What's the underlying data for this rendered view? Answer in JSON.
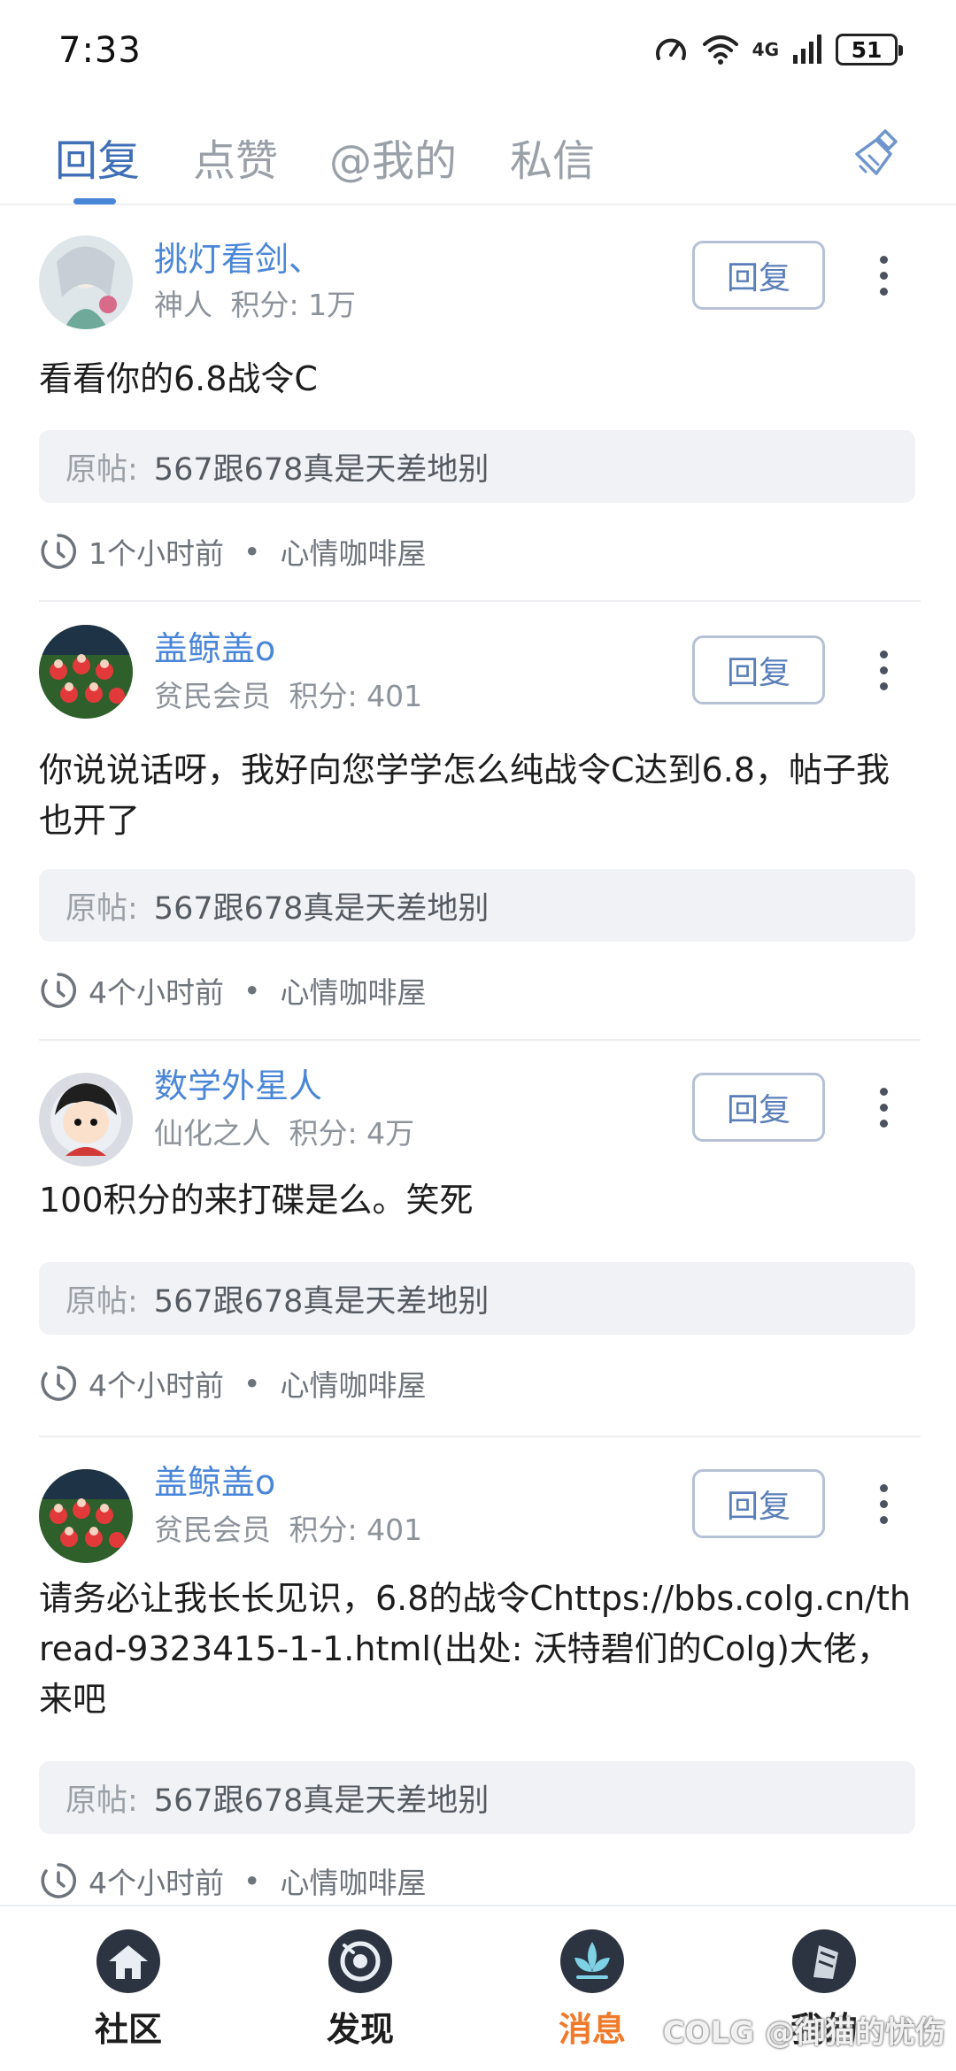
{
  "status_bar": {
    "time": "7:33",
    "network": "4G",
    "battery": "51",
    "icons": [
      "speed-icon",
      "wifi-icon",
      "signal-icon",
      "battery-icon"
    ]
  },
  "tabs": [
    {
      "label": "回复",
      "active": true
    },
    {
      "label": "点赞",
      "active": false
    },
    {
      "label": "@我的",
      "active": false
    },
    {
      "label": "私信",
      "active": false
    }
  ],
  "clear_icon": "broom-icon",
  "messages": [
    {
      "username": "挑灯看剑、",
      "rank": "神人",
      "points": "积分: 1万",
      "reply_label": "回复",
      "content": "看看你的6.8战令C",
      "orig_label": "原帖:",
      "orig_title": "567跟678真是天差地别",
      "time": "1个小时前",
      "forum": "心情咖啡屋"
    },
    {
      "username": "盖鲸盖o",
      "rank": "贫民会员",
      "points": "积分: 401",
      "reply_label": "回复",
      "content": "你说说话呀，我好向您学学怎么纯战令C达到6.8，帖子我也开了",
      "orig_label": "原帖:",
      "orig_title": "567跟678真是天差地别",
      "time": "4个小时前",
      "forum": "心情咖啡屋"
    },
    {
      "username": "数学外星人",
      "rank": "仙化之人",
      "points": "积分: 4万",
      "reply_label": "回复",
      "content": "100积分的来打碟是么。笑死",
      "orig_label": "原帖:",
      "orig_title": "567跟678真是天差地别",
      "time": "4个小时前",
      "forum": "心情咖啡屋"
    },
    {
      "username": "盖鲸盖o",
      "rank": "贫民会员",
      "points": "积分: 401",
      "reply_label": "回复",
      "content": "请务必让我长长见识，6.8的战令Chttps://bbs.colg.cn/thread-9323415-1-1.html(出处: 沃特碧们的Colg)大佬，来吧",
      "orig_label": "原帖:",
      "orig_title": "567跟678真是天差地别",
      "time": "4个小时前",
      "forum": "心情咖啡屋"
    }
  ],
  "bottom_nav": [
    {
      "label": "社区",
      "icon": "community-icon",
      "active": false
    },
    {
      "label": "发现",
      "icon": "discover-icon",
      "active": false
    },
    {
      "label": "消息",
      "icon": "message-icon",
      "active": true
    },
    {
      "label": "我的",
      "icon": "profile-icon",
      "active": false
    }
  ],
  "watermark": "COLG @御猫的忧伤",
  "colors": {
    "accent": "#4a86d8",
    "active_tab": "#3f6fb6",
    "active_nav": "#f07a2a"
  }
}
